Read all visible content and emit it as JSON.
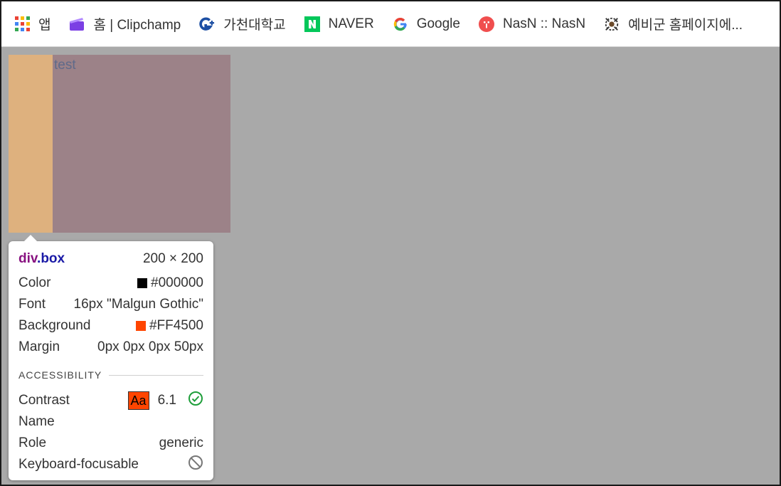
{
  "bookmarks": [
    {
      "label": "앱",
      "icon": "apps-grid-icon"
    },
    {
      "label": "홈 | Clipchamp",
      "icon": "clipchamp-icon"
    },
    {
      "label": "가천대학교",
      "icon": "gachon-icon"
    },
    {
      "label": "NAVER",
      "icon": "naver-icon"
    },
    {
      "label": "Google",
      "icon": "google-icon"
    },
    {
      "label": "NasN :: NasN",
      "icon": "nasn-icon"
    },
    {
      "label": "예비군 홈페이지에...",
      "icon": "reserve-forces-icon"
    }
  ],
  "page": {
    "box_text": "test",
    "margin_color": "#deb17e",
    "content_color": "#9c8288"
  },
  "inspector": {
    "selector_tag": "div",
    "selector_class": ".box",
    "dimensions": "200 × 200",
    "color_label": "Color",
    "color_value": "#000000",
    "font_label": "Font",
    "font_value": "16px \"Malgun Gothic\"",
    "background_label": "Background",
    "background_value": "#FF4500",
    "margin_label": "Margin",
    "margin_value": "0px 0px 0px 50px",
    "accessibility_heading": "ACCESSIBILITY",
    "contrast_label": "Contrast",
    "contrast_sample": "Aa",
    "contrast_value": "6.1",
    "name_label": "Name",
    "role_label": "Role",
    "role_value": "generic",
    "keyboard_label": "Keyboard-focusable"
  }
}
